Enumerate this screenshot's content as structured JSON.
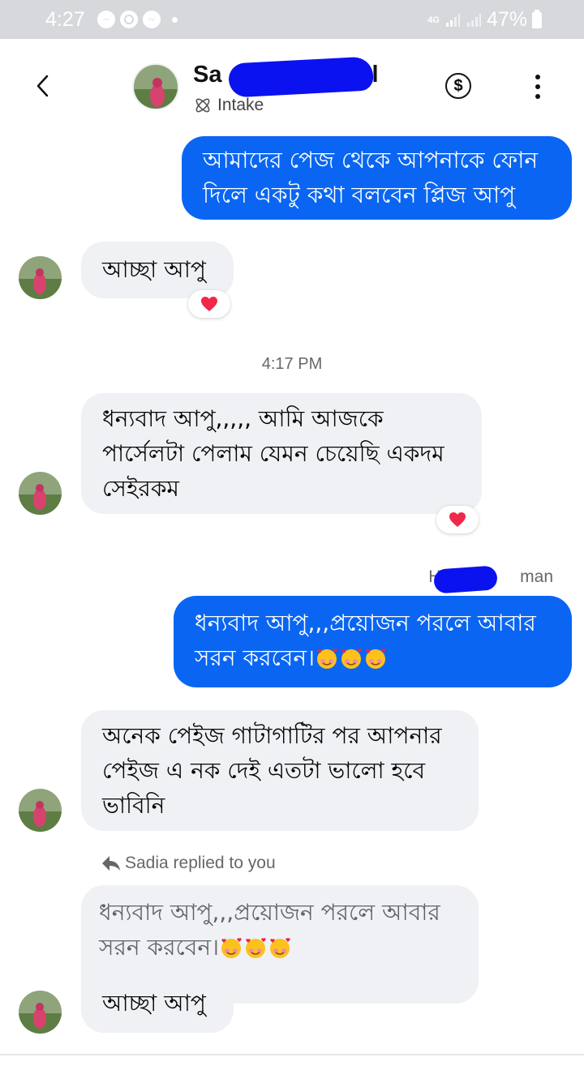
{
  "status_bar": {
    "time": "4:27",
    "network": "4G",
    "battery": "47%",
    "icons": [
      "messenger-icon",
      "whatsapp-icon",
      "messenger-icon"
    ]
  },
  "header": {
    "name_visible": "Sa",
    "name_tail": "l",
    "label": "Intake",
    "icons": [
      "back-icon",
      "intake-icon",
      "dollar-icon",
      "more-icon"
    ]
  },
  "messages": {
    "m1": {
      "line1": "আমাদের পেজ থেকে আপনাকে ফোন",
      "line2": "দিলে একটু কথা বলবেন প্লিজ আপু"
    },
    "m2": {
      "text": "আচ্ছা আপু",
      "reaction": "❤"
    },
    "timestamp": "4:17 PM",
    "m3": {
      "line1": "ধন্যবাদ আপু,,,,, আমি আজকে",
      "line2": "পার্সেলটা পেলাম যেমন চেয়েছি একদম",
      "line3": "সেইরকম",
      "reaction": "❤"
    },
    "sender_prefix": "Ha",
    "sender_suffix": "man",
    "m4": {
      "line1": "ধন্যবাদ আপু,,,প্রয়োজন পরলে আবার",
      "line2": "সরন করবেন।"
    },
    "m5": {
      "line1": "অনেক পেইজ গাটাগাটির পর আপনার",
      "line2": "পেইজ এ নক দেই এতটা ভালো হবে",
      "line3": "ভাবিনি"
    },
    "reply_label": "Sadia replied to you",
    "quoted": {
      "line1": "ধন্যবাদ আপু,,,প্রয়োজন পরলে আবার",
      "line2": "সরন করবেন।"
    },
    "m6": {
      "text": "আচ্ছা আপু"
    }
  },
  "colors": {
    "outgoing": "#0a66f2",
    "incoming": "#f0f1f4",
    "redaction": "#0b12f0",
    "heart": "#f0284a"
  }
}
